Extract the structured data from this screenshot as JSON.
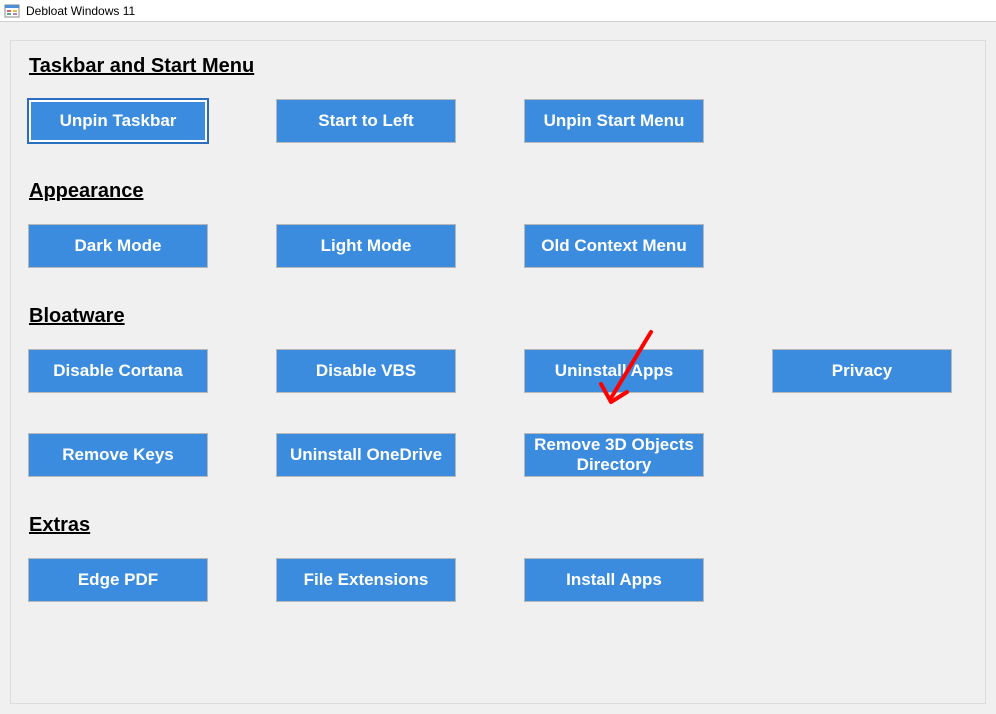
{
  "window": {
    "title": "Debloat Windows 11"
  },
  "sections": {
    "taskbar": {
      "heading": "Taskbar and Start Menu",
      "buttons": {
        "unpin_taskbar": "Unpin Taskbar",
        "start_to_left": "Start to Left",
        "unpin_start_menu": "Unpin Start Menu"
      }
    },
    "appearance": {
      "heading": "Appearance",
      "buttons": {
        "dark_mode": "Dark Mode",
        "light_mode": "Light Mode",
        "old_context_menu": "Old Context Menu"
      }
    },
    "bloatware": {
      "heading": "Bloatware",
      "buttons": {
        "disable_cortana": "Disable Cortana",
        "disable_vbs": "Disable VBS",
        "uninstall_apps": "Uninstall Apps",
        "privacy": "Privacy",
        "remove_keys": "Remove Keys",
        "uninstall_onedrive": "Uninstall OneDrive",
        "remove_3d_objects": "Remove 3D Objects Directory"
      }
    },
    "extras": {
      "heading": "Extras",
      "buttons": {
        "edge_pdf": "Edge PDF",
        "file_extensions": "File Extensions",
        "install_apps": "Install Apps"
      }
    }
  },
  "annotation": {
    "type": "arrow",
    "color": "#ff0000",
    "target": "uninstall-apps-button"
  }
}
